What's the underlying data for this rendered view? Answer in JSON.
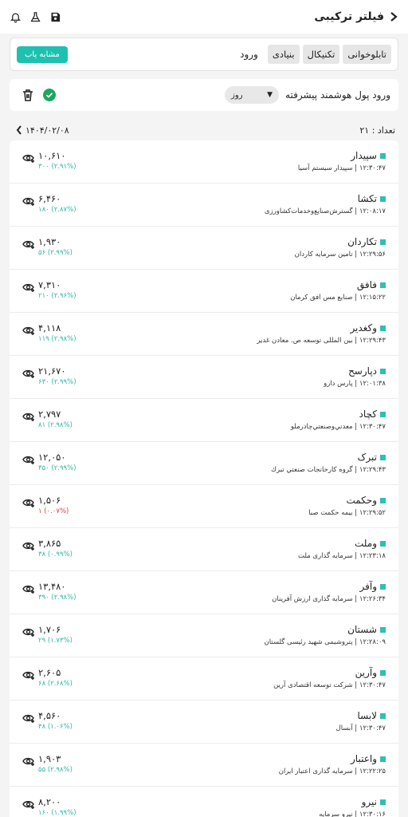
{
  "header": {
    "title": "فیلتر ترکیبی",
    "icons": [
      "bell-icon",
      "flask-icon",
      "save-icon",
      "chevron-left-icon"
    ]
  },
  "filter": {
    "tabs": [
      "تابلوخوانی",
      "تکنیکال",
      "بنیادی"
    ],
    "login_label": "ورود",
    "similar_button": "مشابه یاب"
  },
  "smart_money": {
    "label": "ورود پول هوشمند پیشرفته",
    "period_value": "روز"
  },
  "count": {
    "label": "تعداد : ۲۱",
    "date": "۱۴۰۴/۰۲/۰۸"
  },
  "colors": {
    "accent": "#1ec1b0",
    "positive": "#2fb7a5",
    "negative": "#d64545"
  },
  "rows": [
    {
      "symbol": "سپیدار",
      "sub": "۱۲:۳۰:۴۷ | سپیدار سیستم آسیا",
      "price": "۱۰,۶۱۰",
      "change": "۳۰۰ (۲.۹۱%)",
      "negative": false
    },
    {
      "symbol": "تکشا",
      "sub": "۱۲:۰۸:۱۷ | گسترش‌صنایع‌وخدمات‌کشاورزی",
      "price": "۶,۴۶۰",
      "change": "۱۸۰ (۲.۸۷%)",
      "negative": false
    },
    {
      "symbol": "تکاردان",
      "sub": "۱۲:۲۹:۵۶ | تامین سرمایه کاردان",
      "price": "۱,۹۳۰",
      "change": "۵۶ (۲.۹۹%)",
      "negative": false
    },
    {
      "symbol": "فافق",
      "sub": "۱۲:۱۵:۲۲ | صنایع مس افق کرمان",
      "price": "۷,۳۱۰",
      "change": "۲۱۰ (۲.۹۶%)",
      "negative": false
    },
    {
      "symbol": "وکغدیر",
      "sub": "۱۲:۲۹:۴۳ | بین المللی توسعه ص. معادن غدیر",
      "price": "۴,۱۱۸",
      "change": "۱۱۹ (۲.۹۸%)",
      "negative": false
    },
    {
      "symbol": "دپارسح",
      "sub": "۱۲:۰۱:۳۸ | پارس دارو",
      "price": "۲۱,۶۷۰",
      "change": "۶۳۰ (۲.۹۹%)",
      "negative": false
    },
    {
      "symbol": "کچاد",
      "sub": "۱۲:۳۰:۴۷ | معدني‌وصنعتي‌چادرملو",
      "price": "۲,۷۹۷",
      "change": "۸۱ (۲.۹۸%)",
      "negative": false
    },
    {
      "symbol": "تبرک",
      "sub": "۱۲:۲۹:۴۳ | گروه كارخانجات صنعتي تبرك",
      "price": "۱۲,۰۵۰",
      "change": "۳۵۰ (۲.۹۹%)",
      "negative": false
    },
    {
      "symbol": "وحکمت",
      "sub": "۱۲:۲۹:۵۲ | بیمه حکمت صبا",
      "price": "۱,۵۰۶",
      "change": "۱ (۰.۰۷%)",
      "negative": true
    },
    {
      "symbol": "وملت",
      "sub": "۱۲:۲۳:۱۸ | سرمایه گذاری ملت",
      "price": "۳,۸۶۵",
      "change": "۳۸ (۰.۹۹%)",
      "negative": false
    },
    {
      "symbol": "وآفر",
      "sub": "۱۲:۲۶:۳۴ | سرمایه گذاری ارزش آفرینان",
      "price": "۱۳,۴۸۰",
      "change": "۳۹۰ (۲.۹۸%)",
      "negative": false
    },
    {
      "symbol": "شستان",
      "sub": "۱۲:۲۸:۰۹ | پتروشیمی شهید رئیسی گلستان",
      "price": "۱,۷۰۶",
      "change": "۲۹ (۱.۷۳%)",
      "negative": false
    },
    {
      "symbol": "وآرین",
      "sub": "۱۲:۳۰:۴۷ | شرکت توسعه اقتصادی آرین",
      "price": "۲,۶۰۵",
      "change": "۶۸ (۲.۶۸%)",
      "negative": false
    },
    {
      "symbol": "لابسا",
      "sub": "۱۲:۳۰:۴۷ | آبسال",
      "price": "۴,۵۶۰",
      "change": "۴۸ (۱.۰۶%)",
      "negative": false
    },
    {
      "symbol": "واعتبار",
      "sub": "۱۲:۲۲:۲۵ | سرمایه گذاری اعتبار ایران",
      "price": "۱,۹۰۳",
      "change": "۵۵ (۲.۹۸%)",
      "negative": false
    },
    {
      "symbol": "نیرو",
      "sub": "۱۲:۳۰:۱۶ | نیرو سرمایه",
      "price": "۸,۲۰۰",
      "change": "۱۶۰ (۱.۹۹%)",
      "negative": false
    }
  ]
}
